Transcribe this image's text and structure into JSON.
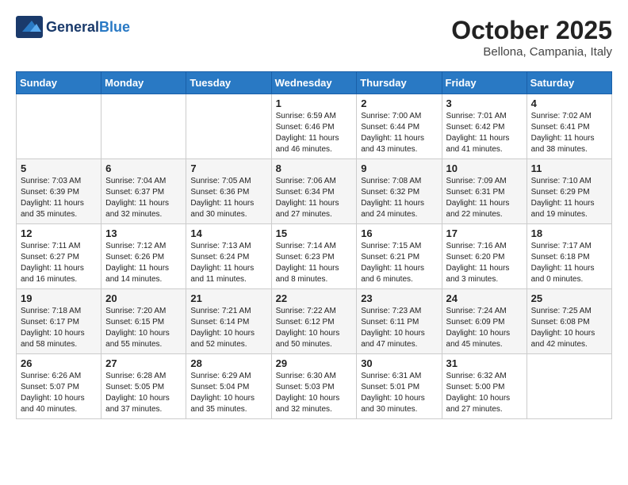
{
  "logo": {
    "general": "General",
    "blue": "Blue"
  },
  "header": {
    "month_year": "October 2025",
    "location": "Bellona, Campania, Italy"
  },
  "weekdays": [
    "Sunday",
    "Monday",
    "Tuesday",
    "Wednesday",
    "Thursday",
    "Friday",
    "Saturday"
  ],
  "weeks": [
    [
      {
        "day": "",
        "info": ""
      },
      {
        "day": "",
        "info": ""
      },
      {
        "day": "",
        "info": ""
      },
      {
        "day": "1",
        "info": "Sunrise: 6:59 AM\nSunset: 6:46 PM\nDaylight: 11 hours\nand 46 minutes."
      },
      {
        "day": "2",
        "info": "Sunrise: 7:00 AM\nSunset: 6:44 PM\nDaylight: 11 hours\nand 43 minutes."
      },
      {
        "day": "3",
        "info": "Sunrise: 7:01 AM\nSunset: 6:42 PM\nDaylight: 11 hours\nand 41 minutes."
      },
      {
        "day": "4",
        "info": "Sunrise: 7:02 AM\nSunset: 6:41 PM\nDaylight: 11 hours\nand 38 minutes."
      }
    ],
    [
      {
        "day": "5",
        "info": "Sunrise: 7:03 AM\nSunset: 6:39 PM\nDaylight: 11 hours\nand 35 minutes."
      },
      {
        "day": "6",
        "info": "Sunrise: 7:04 AM\nSunset: 6:37 PM\nDaylight: 11 hours\nand 32 minutes."
      },
      {
        "day": "7",
        "info": "Sunrise: 7:05 AM\nSunset: 6:36 PM\nDaylight: 11 hours\nand 30 minutes."
      },
      {
        "day": "8",
        "info": "Sunrise: 7:06 AM\nSunset: 6:34 PM\nDaylight: 11 hours\nand 27 minutes."
      },
      {
        "day": "9",
        "info": "Sunrise: 7:08 AM\nSunset: 6:32 PM\nDaylight: 11 hours\nand 24 minutes."
      },
      {
        "day": "10",
        "info": "Sunrise: 7:09 AM\nSunset: 6:31 PM\nDaylight: 11 hours\nand 22 minutes."
      },
      {
        "day": "11",
        "info": "Sunrise: 7:10 AM\nSunset: 6:29 PM\nDaylight: 11 hours\nand 19 minutes."
      }
    ],
    [
      {
        "day": "12",
        "info": "Sunrise: 7:11 AM\nSunset: 6:27 PM\nDaylight: 11 hours\nand 16 minutes."
      },
      {
        "day": "13",
        "info": "Sunrise: 7:12 AM\nSunset: 6:26 PM\nDaylight: 11 hours\nand 14 minutes."
      },
      {
        "day": "14",
        "info": "Sunrise: 7:13 AM\nSunset: 6:24 PM\nDaylight: 11 hours\nand 11 minutes."
      },
      {
        "day": "15",
        "info": "Sunrise: 7:14 AM\nSunset: 6:23 PM\nDaylight: 11 hours\nand 8 minutes."
      },
      {
        "day": "16",
        "info": "Sunrise: 7:15 AM\nSunset: 6:21 PM\nDaylight: 11 hours\nand 6 minutes."
      },
      {
        "day": "17",
        "info": "Sunrise: 7:16 AM\nSunset: 6:20 PM\nDaylight: 11 hours\nand 3 minutes."
      },
      {
        "day": "18",
        "info": "Sunrise: 7:17 AM\nSunset: 6:18 PM\nDaylight: 11 hours\nand 0 minutes."
      }
    ],
    [
      {
        "day": "19",
        "info": "Sunrise: 7:18 AM\nSunset: 6:17 PM\nDaylight: 10 hours\nand 58 minutes."
      },
      {
        "day": "20",
        "info": "Sunrise: 7:20 AM\nSunset: 6:15 PM\nDaylight: 10 hours\nand 55 minutes."
      },
      {
        "day": "21",
        "info": "Sunrise: 7:21 AM\nSunset: 6:14 PM\nDaylight: 10 hours\nand 52 minutes."
      },
      {
        "day": "22",
        "info": "Sunrise: 7:22 AM\nSunset: 6:12 PM\nDaylight: 10 hours\nand 50 minutes."
      },
      {
        "day": "23",
        "info": "Sunrise: 7:23 AM\nSunset: 6:11 PM\nDaylight: 10 hours\nand 47 minutes."
      },
      {
        "day": "24",
        "info": "Sunrise: 7:24 AM\nSunset: 6:09 PM\nDaylight: 10 hours\nand 45 minutes."
      },
      {
        "day": "25",
        "info": "Sunrise: 7:25 AM\nSunset: 6:08 PM\nDaylight: 10 hours\nand 42 minutes."
      }
    ],
    [
      {
        "day": "26",
        "info": "Sunrise: 6:26 AM\nSunset: 5:07 PM\nDaylight: 10 hours\nand 40 minutes."
      },
      {
        "day": "27",
        "info": "Sunrise: 6:28 AM\nSunset: 5:05 PM\nDaylight: 10 hours\nand 37 minutes."
      },
      {
        "day": "28",
        "info": "Sunrise: 6:29 AM\nSunset: 5:04 PM\nDaylight: 10 hours\nand 35 minutes."
      },
      {
        "day": "29",
        "info": "Sunrise: 6:30 AM\nSunset: 5:03 PM\nDaylight: 10 hours\nand 32 minutes."
      },
      {
        "day": "30",
        "info": "Sunrise: 6:31 AM\nSunset: 5:01 PM\nDaylight: 10 hours\nand 30 minutes."
      },
      {
        "day": "31",
        "info": "Sunrise: 6:32 AM\nSunset: 5:00 PM\nDaylight: 10 hours\nand 27 minutes."
      },
      {
        "day": "",
        "info": ""
      }
    ]
  ]
}
